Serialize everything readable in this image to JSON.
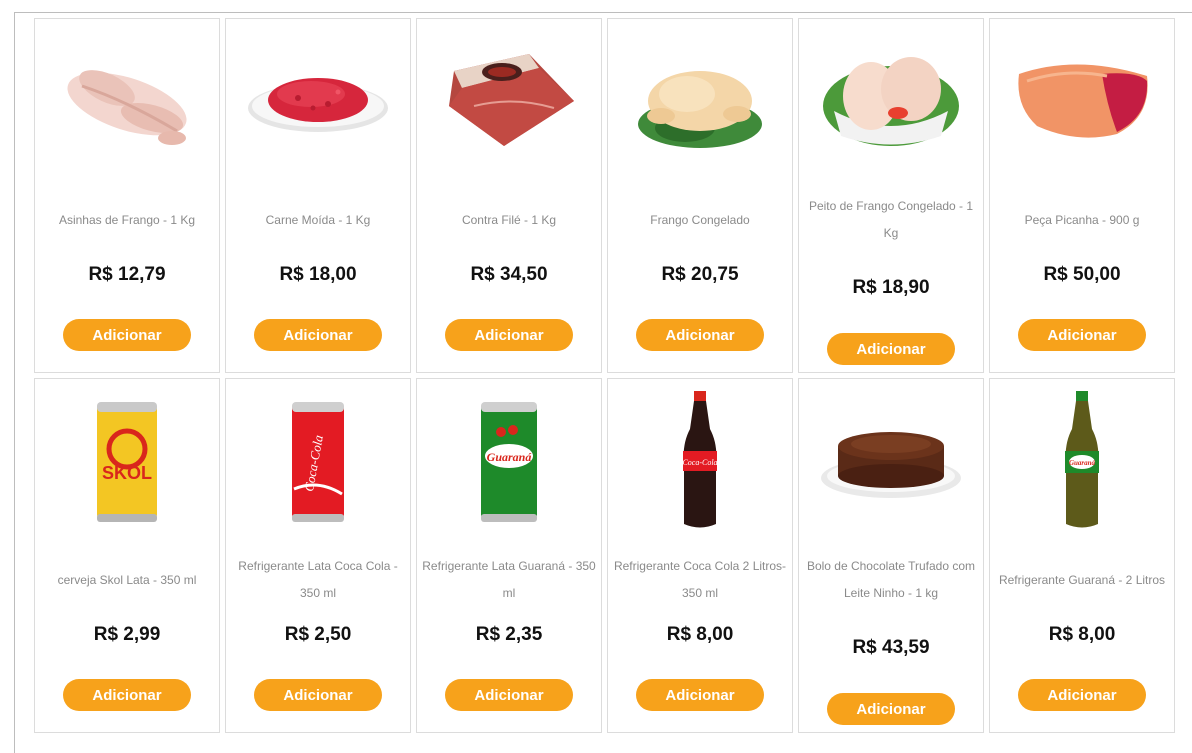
{
  "products": [
    {
      "name": "Asinhas de Frango - 1 Kg",
      "price": "R$ 12,79",
      "button": "Adicionar",
      "image": "chicken-wings-image"
    },
    {
      "name": "Carne Moída - 1 Kg",
      "price": "R$ 18,00",
      "button": "Adicionar",
      "image": "ground-beef-image"
    },
    {
      "name": "Contra Filé - 1 Kg",
      "price": "R$ 34,50",
      "button": "Adicionar",
      "image": "sirloin-steak-image"
    },
    {
      "name": "Frango Congelado",
      "price": "R$ 20,75",
      "button": "Adicionar",
      "image": "whole-chicken-image"
    },
    {
      "name": "Peito de Frango Congelado - 1 Kg",
      "price": "R$ 18,90",
      "button": "Adicionar",
      "image": "chicken-breast-image"
    },
    {
      "name": "Peça Picanha - 900 g",
      "price": "R$ 50,00",
      "button": "Adicionar",
      "image": "picanha-image"
    },
    {
      "name": "cerveja Skol Lata - 350 ml",
      "price": "R$ 2,99",
      "button": "Adicionar",
      "image": "skol-can-image",
      "label": "SKOL"
    },
    {
      "name": "Refrigerante Lata Coca Cola - 350 ml",
      "price": "R$ 2,50",
      "button": "Adicionar",
      "image": "coca-cola-can-image",
      "label": "Coca-Cola"
    },
    {
      "name": "Refrigerante Lata Guaraná - 350 ml",
      "price": "R$ 2,35",
      "button": "Adicionar",
      "image": "guarana-can-image",
      "label": "Guaraná"
    },
    {
      "name": "Refrigerante Coca Cola 2 Litros- 350 ml",
      "price": "R$ 8,00",
      "button": "Adicionar",
      "image": "coca-cola-bottle-image",
      "label": "Coca-Cola"
    },
    {
      "name": "Bolo de Chocolate Trufado com Leite Ninho - 1 kg",
      "price": "R$ 43,59",
      "button": "Adicionar",
      "image": "chocolate-cake-image"
    },
    {
      "name": "Refrigerante Guaraná - 2 Litros",
      "price": "R$ 8,00",
      "button": "Adicionar",
      "image": "guarana-bottle-image",
      "label": "Guaraná"
    }
  ],
  "colors": {
    "button": "#f7a21b",
    "price": "#111111",
    "name": "#8a8a8a",
    "border": "#dcdcdc"
  }
}
